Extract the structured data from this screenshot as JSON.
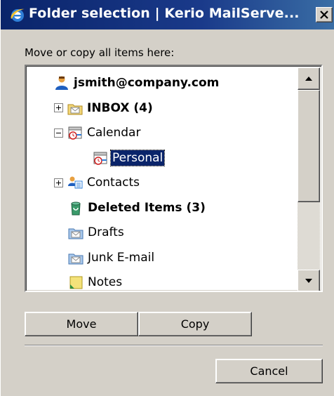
{
  "window": {
    "title": "Folder selection | Kerio MailServe...",
    "icon": "internet-explorer-icon",
    "close_glyph": "✕"
  },
  "dialog": {
    "label": "Move or copy all items here:"
  },
  "tree": [
    {
      "label": "jsmith@company.com",
      "bold": true,
      "icon": "user-icon",
      "expander": "none",
      "selected": false
    },
    {
      "label": "INBOX (4)",
      "bold": true,
      "icon": "inbox-folder-icon",
      "expander": "plus",
      "selected": false
    },
    {
      "label": "Calendar",
      "bold": false,
      "icon": "calendar-icon",
      "expander": "minus",
      "selected": false
    },
    {
      "label": "Personal",
      "bold": false,
      "icon": "calendar-icon",
      "expander": "none",
      "selected": true
    },
    {
      "label": "Contacts",
      "bold": false,
      "icon": "contacts-icon",
      "expander": "plus",
      "selected": false
    },
    {
      "label": "Deleted Items (3)",
      "bold": true,
      "icon": "trash-icon",
      "expander": "none",
      "selected": false
    },
    {
      "label": "Drafts",
      "bold": false,
      "icon": "mail-folder-icon",
      "expander": "none",
      "selected": false
    },
    {
      "label": "Junk E-mail",
      "bold": false,
      "icon": "mail-folder-icon",
      "expander": "none",
      "selected": false
    },
    {
      "label": "Notes",
      "bold": false,
      "icon": "notes-icon",
      "expander": "none",
      "selected": false
    }
  ],
  "buttons": {
    "move": "Move",
    "copy": "Copy",
    "cancel": "Cancel"
  },
  "colors": {
    "titlebar": "#0a246a",
    "dialog_bg": "#d4d0c8",
    "selection": "#0a246a"
  }
}
